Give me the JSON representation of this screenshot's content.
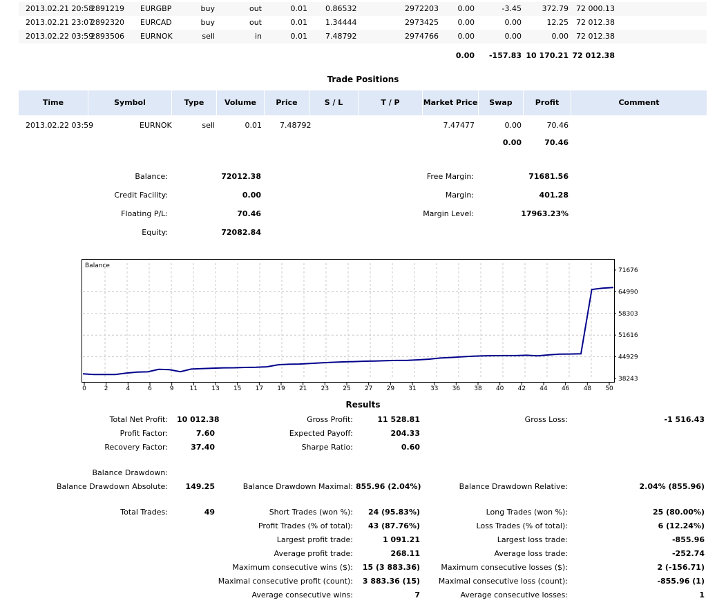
{
  "deals": {
    "rows": [
      {
        "time": "2013.02.21 20:58",
        "deal": "2891219",
        "symbol": "EURGBP",
        "type": "buy",
        "direction": "out",
        "volume": "0.01",
        "price": "0.86532",
        "order": "2972203",
        "commission": "0.00",
        "swap": "-3.45",
        "profit": "372.79",
        "balance": "72 000.13"
      },
      {
        "time": "2013.02.21 23:07",
        "deal": "2892320",
        "symbol": "EURCAD",
        "type": "buy",
        "direction": "out",
        "volume": "0.01",
        "price": "1.34444",
        "order": "2973425",
        "commission": "0.00",
        "swap": "0.00",
        "profit": "12.25",
        "balance": "72 012.38"
      },
      {
        "time": "2013.02.22 03:59",
        "deal": "2893506",
        "symbol": "EURNOK",
        "type": "sell",
        "direction": "in",
        "volume": "0.01",
        "price": "7.48792",
        "order": "2974766",
        "commission": "0.00",
        "swap": "0.00",
        "profit": "0.00",
        "balance": "72 012.38"
      }
    ],
    "totals": {
      "commission": "0.00",
      "swap": "-157.83",
      "profit": "10 170.21",
      "balance": "72 012.38"
    }
  },
  "positions": {
    "title": "Trade Positions",
    "headers": {
      "time": "Time",
      "symbol": "Symbol",
      "type": "Type",
      "volume": "Volume",
      "price": "Price",
      "sl": "S / L",
      "tp": "T / P",
      "market_price": "Market Price",
      "swap": "Swap",
      "profit": "Profit",
      "comment": "Comment"
    },
    "rows": [
      {
        "time": "2013.02.22 03:59",
        "symbol": "EURNOK",
        "type": "sell",
        "volume": "0.01",
        "price": "7.48792",
        "sl": "",
        "tp": "",
        "market_price": "7.47477",
        "swap": "0.00",
        "profit": "70.46",
        "comment": ""
      }
    ],
    "totals": {
      "swap": "0.00",
      "profit": "70.46"
    }
  },
  "account": {
    "balance_label": "Balance:",
    "balance": "72012.38",
    "credit_label": "Credit Facility:",
    "credit": "0.00",
    "floating_label": "Floating P/L:",
    "floating": "70.46",
    "equity_label": "Equity:",
    "equity": "72082.84",
    "free_margin_label": "Free Margin:",
    "free_margin": "71681.56",
    "margin_label": "Margin:",
    "margin": "401.28",
    "margin_level_label": "Margin Level:",
    "margin_level": "17963.23%"
  },
  "chart_data": {
    "type": "line",
    "title": "Balance",
    "x": [
      0,
      1,
      2,
      3,
      4,
      5,
      6,
      7,
      8,
      9,
      10,
      11,
      12,
      13,
      14,
      15,
      16,
      17,
      18,
      19,
      20,
      21,
      22,
      23,
      24,
      25,
      26,
      27,
      28,
      29,
      30,
      31,
      32,
      33,
      34,
      35,
      36,
      37,
      38,
      39,
      40,
      41,
      42,
      43,
      44,
      45,
      46,
      47,
      48,
      49
    ],
    "series": [
      {
        "values": [
          39660,
          39450,
          39450,
          39450,
          39880,
          40200,
          40280,
          41050,
          40950,
          40330,
          41140,
          41280,
          41420,
          41530,
          41550,
          41640,
          41700,
          41850,
          42440,
          42620,
          42700,
          42860,
          43050,
          43230,
          43350,
          43430,
          43560,
          43600,
          43720,
          43800,
          43850,
          44000,
          44200,
          44550,
          44720,
          44920,
          45100,
          45200,
          45260,
          45290,
          45300,
          45400,
          45200,
          45500,
          45750,
          45780,
          45850,
          65700,
          66100,
          66300
        ]
      }
    ],
    "xticks": [
      "0",
      "2",
      "4",
      "6",
      "9",
      "11",
      "13",
      "15",
      "17",
      "19",
      "21",
      "23",
      "25",
      "27",
      "29",
      "31",
      "33",
      "36",
      "38",
      "40",
      "42",
      "44",
      "46",
      "48",
      "50"
    ],
    "yticks": [
      "71676",
      "64990",
      "58303",
      "51616",
      "44929",
      "38243"
    ],
    "ylim": [
      38243,
      71676
    ],
    "xlim": [
      0,
      50
    ],
    "grid": true,
    "line_color": "#00008b"
  },
  "results": {
    "title": "Results",
    "total_net_profit_label": "Total Net Profit:",
    "total_net_profit": "10 012.38",
    "gross_profit_label": "Gross Profit:",
    "gross_profit": "11 528.81",
    "gross_loss_label": "Gross Loss:",
    "gross_loss": "-1 516.43",
    "profit_factor_label": "Profit Factor:",
    "profit_factor": "7.60",
    "expected_payoff_label": "Expected Payoff:",
    "expected_payoff": "204.33",
    "recovery_factor_label": "Recovery Factor:",
    "recovery_factor": "37.40",
    "sharpe_ratio_label": "Sharpe Ratio:",
    "sharpe_ratio": "0.60",
    "balance_drawdown_label": "Balance Drawdown:",
    "bd_absolute_label": "Balance Drawdown Absolute:",
    "bd_absolute": "149.25",
    "bd_maximal_label": "Balance Drawdown Maximal:",
    "bd_maximal": "855.96 (2.04%)",
    "bd_relative_label": "Balance Drawdown Relative:",
    "bd_relative": "2.04% (855.96)",
    "total_trades_label": "Total Trades:",
    "total_trades": "49",
    "short_trades_label": "Short Trades (won %):",
    "short_trades": "24 (95.83%)",
    "long_trades_label": "Long Trades (won %):",
    "long_trades": "25 (80.00%)",
    "profit_trades_label": "Profit Trades (% of total):",
    "profit_trades": "43 (87.76%)",
    "loss_trades_label": "Loss Trades (% of total):",
    "loss_trades": "6 (12.24%)",
    "largest_profit_label": "Largest profit trade:",
    "largest_profit": "1 091.21",
    "largest_loss_label": "Largest loss trade:",
    "largest_loss": "-855.96",
    "avg_profit_label": "Average profit trade:",
    "avg_profit": "268.11",
    "avg_loss_label": "Average loss trade:",
    "avg_loss": "-252.74",
    "max_consec_wins_label": "Maximum consecutive wins ($):",
    "max_consec_wins": "15 (3 883.36)",
    "max_consec_losses_label": "Maximum consecutive losses ($):",
    "max_consec_losses": "2 (-156.71)",
    "maximal_consec_profit_label": "Maximal consecutive profit (count):",
    "maximal_consec_profit": "3 883.36 (15)",
    "maximal_consec_loss_label": "Maximal consecutive loss (count):",
    "maximal_consec_loss": "-855.96 (1)",
    "avg_consec_wins_label": "Average consecutive wins:",
    "avg_consec_wins": "7",
    "avg_consec_losses_label": "Average consecutive losses:",
    "avg_consec_losses": "1"
  }
}
